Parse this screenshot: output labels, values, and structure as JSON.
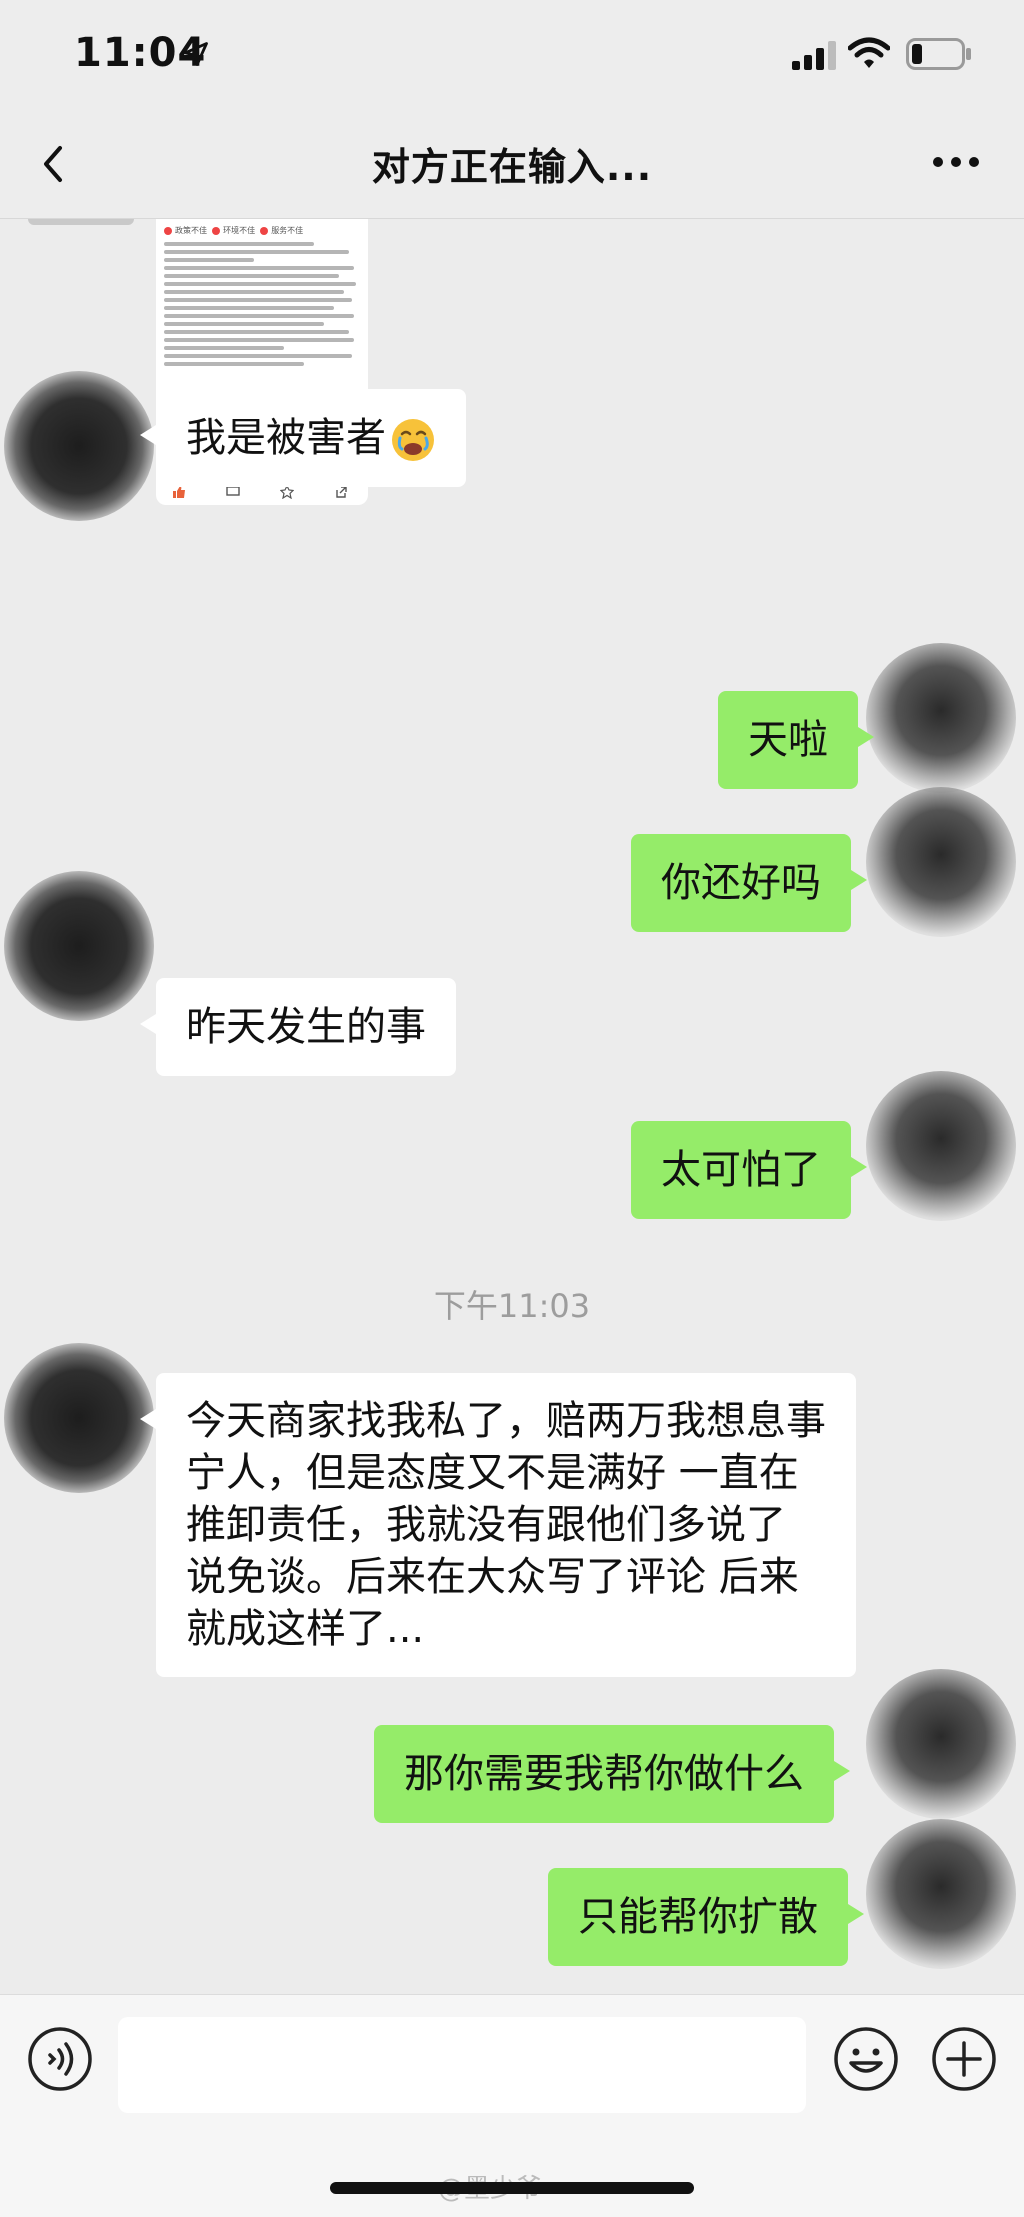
{
  "status_bar": {
    "time": "11:04",
    "icons": [
      "location-arrow-icon",
      "signal-icon",
      "wifi-icon",
      "battery-icon"
    ]
  },
  "nav": {
    "title": "对方正在输入...",
    "back_icon": "chevron-left-icon",
    "more_icon": "more-dots-icon"
  },
  "shared_image": {
    "tags": [
      "政策不佳",
      "环境不佳",
      "服务不佳"
    ],
    "action_icons": [
      "like-icon",
      "comment-icon",
      "star-icon",
      "share-icon"
    ]
  },
  "messages": [
    {
      "sender": "other",
      "text": "我是被害者",
      "emoji": "face-with-hand-over-mouth"
    },
    {
      "sender": "me",
      "text": "天啦"
    },
    {
      "sender": "me",
      "text": "你还好吗"
    },
    {
      "sender": "other",
      "text": "昨天发生的事"
    },
    {
      "sender": "me",
      "text": "太可怕了"
    },
    {
      "sender": "other",
      "text": "今天商家找我私了，赔两万我想息事宁人，但是态度又不是满好 一直在推卸责任，我就没有跟他们多说了 说免谈。后来在大众写了评论 后来就成这样了..."
    },
    {
      "sender": "me",
      "text": "那你需要我帮你做什么"
    },
    {
      "sender": "me",
      "text": "只能帮你扩散"
    }
  ],
  "timestamp": "下午11:03",
  "input_bar": {
    "placeholder": "",
    "voice_icon": "voice-icon",
    "emoji_icon": "emoji-icon",
    "plus_icon": "plus-icon"
  },
  "watermark": "@墨少爷",
  "colors": {
    "background": "#ececec",
    "bubble_out": "#95ec69",
    "bubble_in": "#ffffff",
    "timestamp": "#9d9d9d"
  }
}
